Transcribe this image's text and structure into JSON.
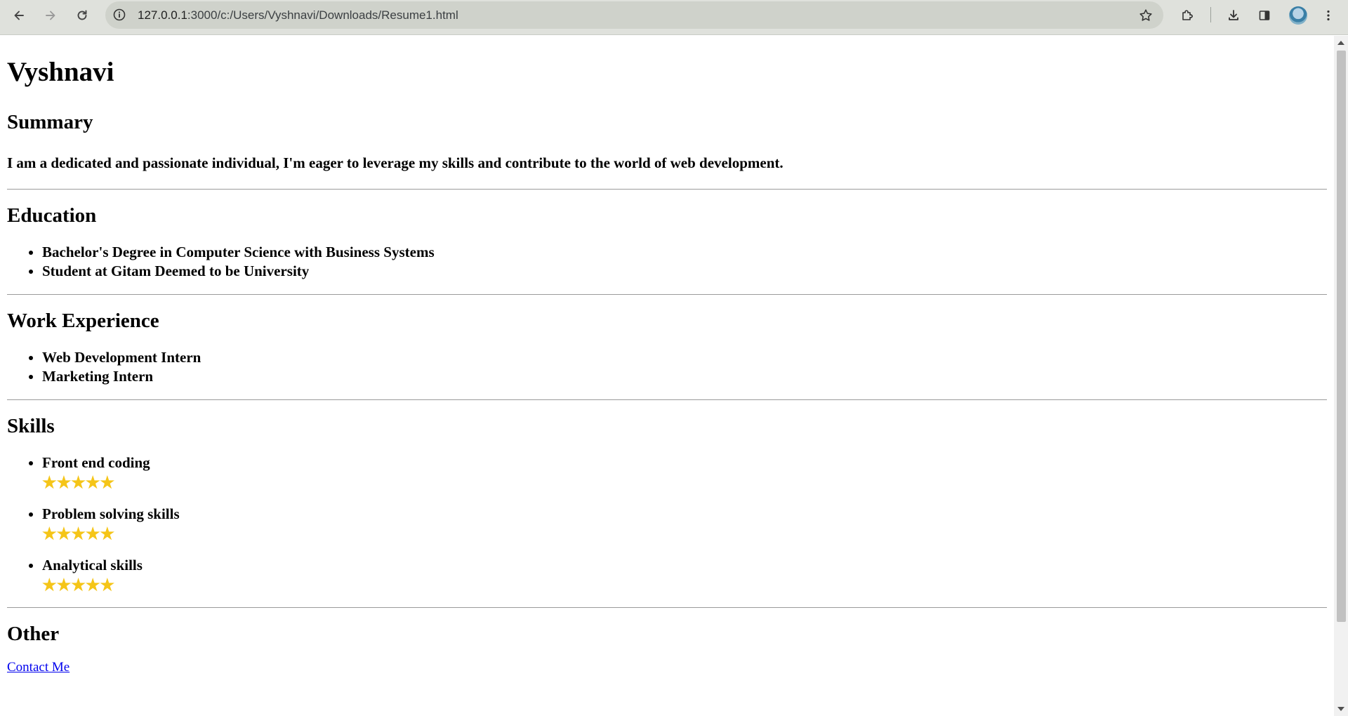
{
  "browser": {
    "url_host": "127.0.0.1",
    "url_rest": ":3000/c:/Users/Vyshnavi/Downloads/Resume1.html",
    "icons": [
      "back-icon",
      "forward-icon",
      "reload-icon",
      "site-info-icon",
      "bookmark-star-icon",
      "extensions-icon",
      "download-icon",
      "side-panel-icon",
      "profile-avatar",
      "menu-icon"
    ]
  },
  "resume": {
    "name": "Vyshnavi",
    "summary": {
      "title": "Summary",
      "text": "I am a dedicated and passionate individual, I'm eager to leverage my skills and contribute to the world of web development."
    },
    "education": {
      "title": "Education",
      "items": [
        "Bachelor's Degree in Computer Science with Business Systems",
        "Student at Gitam Deemed to be University"
      ]
    },
    "work": {
      "title": "Work Experience",
      "items": [
        "Web Development Intern",
        "Marketing Intern"
      ]
    },
    "skills": {
      "title": "Skills",
      "star_glyph": "★★★★★",
      "items": [
        {
          "label": "Front end coding",
          "rating": 5,
          "max": 5
        },
        {
          "label": "Problem solving skills",
          "rating": 5,
          "max": 5
        },
        {
          "label": "Analytical skills",
          "rating": 5,
          "max": 5
        }
      ]
    },
    "other": {
      "title": "Other",
      "link": "Contact Me"
    }
  },
  "colors": {
    "star": "#f5c518",
    "link": "#0000ee",
    "toolbar": "#dfe1dc"
  }
}
